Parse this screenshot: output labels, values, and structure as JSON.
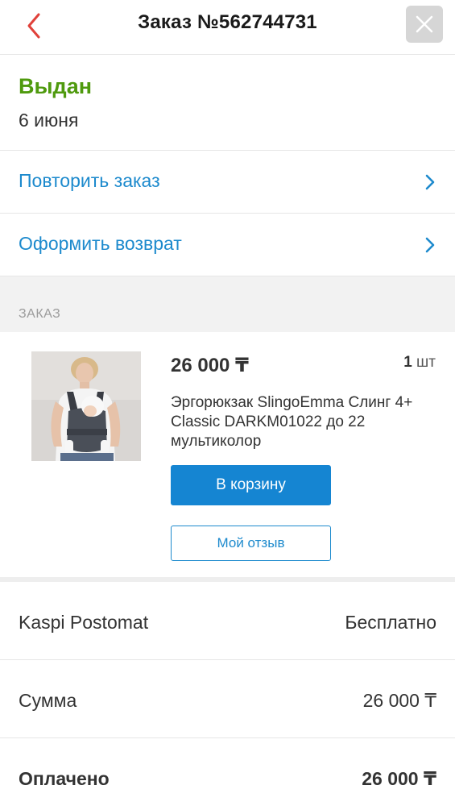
{
  "header": {
    "title": "Заказ №562744731",
    "back_icon": "chevron-left-icon",
    "close_icon": "close-icon"
  },
  "status": {
    "label": "Выдан",
    "date": "6 июня",
    "color": "#4f9a0e"
  },
  "actions": [
    {
      "label": "Повторить заказ"
    },
    {
      "label": "Оформить возврат"
    }
  ],
  "order_section": {
    "title": "ЗАКАЗ"
  },
  "product": {
    "price": "26 000 ₸",
    "qty_number": "1",
    "qty_unit": "шт",
    "name": "Эргорюкзак SlingoEmma Слинг 4+ Classic DARKM01022 до 22 мультиколор",
    "cart_button": "В корзину",
    "review_button": "Мой отзыв"
  },
  "summary": [
    {
      "key": "Kaspi Postomat",
      "value": "Бесплатно"
    },
    {
      "key": "Сумма",
      "value": "26 000 ₸"
    },
    {
      "key": "Оплачено",
      "value": "26 000 ₸"
    }
  ],
  "colors": {
    "accent": "#1585d2",
    "link": "#1d8acd",
    "back": "#e0413a"
  }
}
